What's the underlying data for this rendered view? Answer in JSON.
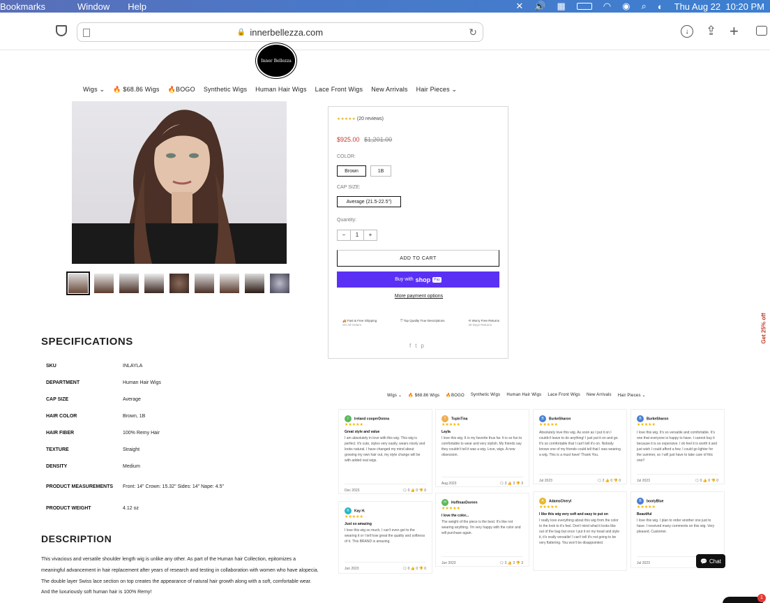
{
  "macbar": {
    "menus": [
      "Bookmarks",
      "Window",
      "Help"
    ],
    "clock": "Thu Aug 22  10:20 PM"
  },
  "browser": {
    "url": "innerbellezza.com"
  },
  "logo": {
    "text": "Inner Bellezza"
  },
  "nav": {
    "items": [
      "Wigs",
      "🔥 $68.86 Wigs",
      "🔥BOGO",
      "Synthetic Wigs",
      "Human Hair Wigs",
      "Lace Front Wigs",
      "New Arrivals",
      "Hair Pieces"
    ]
  },
  "product": {
    "reviews": "(20 reviews)",
    "price": "$925.00",
    "compare_price": "$1,201.00",
    "color_label": "COLOR:",
    "colors": [
      "Brown",
      "1B"
    ],
    "cap_label": "CAP SIZE:",
    "cap_sizes": [
      "Average (21.5-22.5\")"
    ],
    "qty_label": "Quantity:",
    "qty_value": "1",
    "add_to_cart": "ADD TO CART",
    "shop_pay_prefix": "Buy with",
    "shop_pay": "shop",
    "shop_pay_badge": "Pay",
    "more_payment": "More payment options",
    "benefits": [
      "Fast & Free Shipping",
      "Top Quality True Descriptions",
      "Worry Free Returns"
    ],
    "benefit_subs": [
      "On All Orders",
      "",
      "30 Days Returns"
    ]
  },
  "side_tab": {
    "label": "Get 25% off"
  },
  "specs": {
    "title": "SPECIFICATIONS",
    "rows": [
      [
        "SKU",
        "INLAYLA"
      ],
      [
        "DEPARTMENT",
        "Human Hair Wigs"
      ],
      [
        "CAP SIZE",
        "Average"
      ],
      [
        "HAIR COLOR",
        "Brown, 1B"
      ],
      [
        "HAIR FIBER",
        "100% Remy Hair"
      ],
      [
        "TEXTURE",
        "Straight"
      ],
      [
        "DENSITY",
        "Medium"
      ],
      [
        "PRODUCT MEASUREMENTS",
        "Front: 14\" Crown: 15.32\" Sides: 14\" Nape: 4.5\""
      ],
      [
        "PRODUCT WEIGHT",
        "4.12 oz"
      ]
    ]
  },
  "description": {
    "title": "DESCRIPTION",
    "text": "This vivacious and versatile shoulder length wig is unlike any other. As part of the Human hair Collection, epitomizes a meaningful advancement in hair replacement after years of research and testing in collaboration with women who have alopecia. The double layer Swiss lace section on top creates the appearance of natural hair growth along with a soft, comfortable wear. And the luxuriously soft human hair is 100% Remy!"
  },
  "reviews": [
    {
      "initial": "I",
      "name": "Ireland cooperDonna",
      "color": "#5cb85c",
      "title": "Great style and value",
      "body": "I am absolutely in love with this wig. This wig is perfect. It's cute, styles very easily, wears nicely and looks natural. I have changed my mind about growing my own hair out, my style change will be with added real wigs.",
      "date": "Dec 2023",
      "votes": [
        "0",
        "0",
        "0"
      ]
    },
    {
      "initial": "T",
      "name": "TopinTina",
      "color": "#f0ad4e",
      "title": "Layla",
      "body": "I love this wig. It is my favorite thus far. It is so fun to comfortable to wear and very stylish. My friends say they couldn't tell it was a wig. Love, wigs. A new obsession.",
      "date": "Aug 2023",
      "votes": [
        "3",
        "3",
        "3"
      ]
    },
    {
      "initial": "B",
      "name": "BurkeSharon",
      "color": "#4a7fd0",
      "title": "",
      "body": "Absolutely love this wig. As soon as I put it on I couldn't leave to do anything! I just put it on and go. It's so comfortable that I can't tell it's on. Nobody knows one of my friends could tell that I was wearing a wig. This is a must have! Thank You.",
      "date": "Jul 2023",
      "votes": [
        "2",
        "0",
        "0"
      ]
    },
    {
      "initial": "B",
      "name": "BurkeSharon",
      "color": "#4a7fd0",
      "title": "",
      "body": "I love this wig. It's so versatile and comfortable. It's one that everyone is happy to have. I cannot buy it because it is so expensive. I do feel it is worth it and just wish I could afford a few. I could go lighter for the summer, so I will just have to take care of this one!!",
      "date": "Jul 2023",
      "votes": [
        "0",
        "0",
        "0"
      ]
    },
    {
      "initial": "K",
      "name": "Kay H.",
      "color": "#2bb5c7",
      "title": "Just so amazing",
      "body": "I love this wig so much, I can't even get to the wearing it or I tell how great the quality and softness of it. This BRAND is amazing.",
      "date": "Jun 2023",
      "votes": [
        "0",
        "0",
        "0"
      ]
    },
    {
      "initial": "H",
      "name": "HoffmanDoreen",
      "color": "#5cb85c",
      "title": "I love the color...",
      "body": "The weight of the piece is the best. It's like not wearing anything. I'm very happy with the color and will purchase again.",
      "date": "Jun 2023",
      "votes": [
        "3",
        "3",
        "3"
      ]
    },
    {
      "initial": "A",
      "name": "AdamsCheryl",
      "color": "#e6b82e",
      "title": "I like this wig very soft and easy to put on",
      "body": "I really love everything about this wig from the color to the look to it's feel. Don't mind what it looks like out of the bag but once I put it on my head and style it, it's really versatile! I can't tell it's not going to be very flattering. You won't be disappointed.",
      "date": "May 2023",
      "votes": [
        "0",
        "0",
        "0"
      ]
    },
    {
      "initial": "B",
      "name": "bootyBlue",
      "color": "#4a7fd0",
      "title": "Beautiful",
      "body": "I love this wig. I plan to order another one just to have. I received many comments on this wig. Very pleased. Customer.",
      "date": "Jul 2023",
      "votes": [
        "0",
        "0",
        "0"
      ]
    }
  ],
  "chat": {
    "label": "Chat",
    "badge": "1"
  }
}
